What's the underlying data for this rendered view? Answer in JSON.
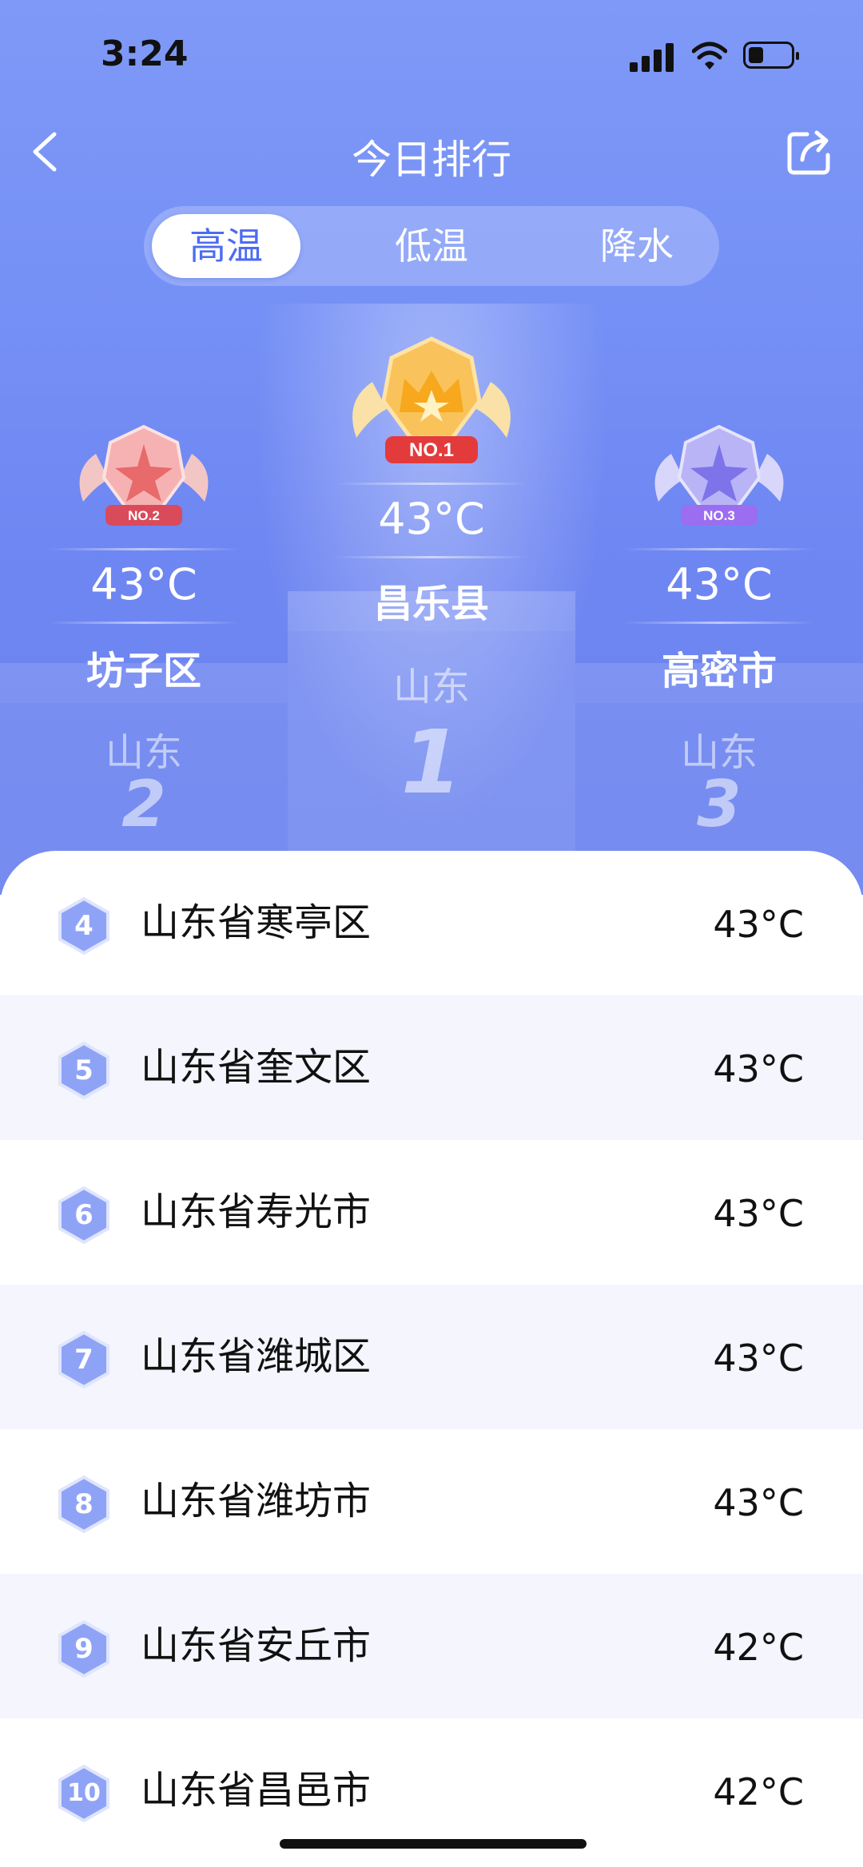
{
  "status_bar": {
    "time": "3:24"
  },
  "header": {
    "title": "今日排行"
  },
  "tabs": [
    {
      "label": "高温",
      "active": true
    },
    {
      "label": "低温",
      "active": false
    },
    {
      "label": "降水",
      "active": false
    }
  ],
  "podium": {
    "first": {
      "badge": "NO.1",
      "temp": "43°C",
      "name": "昌乐县",
      "province": "山东",
      "rank": "1"
    },
    "second": {
      "badge": "NO.2",
      "temp": "43°C",
      "name": "坊子区",
      "province": "山东",
      "rank": "2"
    },
    "third": {
      "badge": "NO.3",
      "temp": "43°C",
      "name": "高密市",
      "province": "山东",
      "rank": "3"
    }
  },
  "ranking": [
    {
      "rank": "4",
      "place": "山东省寒亭区",
      "temp": "43°C"
    },
    {
      "rank": "5",
      "place": "山东省奎文区",
      "temp": "43°C"
    },
    {
      "rank": "6",
      "place": "山东省寿光市",
      "temp": "43°C"
    },
    {
      "rank": "7",
      "place": "山东省潍城区",
      "temp": "43°C"
    },
    {
      "rank": "8",
      "place": "山东省潍坊市",
      "temp": "43°C"
    },
    {
      "rank": "9",
      "place": "山东省安丘市",
      "temp": "42°C"
    },
    {
      "rank": "10",
      "place": "山东省昌邑市",
      "temp": "42°C"
    }
  ],
  "colors": {
    "accent": "#4c6cf0",
    "hero": "#7590f6",
    "gold": "#f7b52c",
    "silver_red": "#e86a6a",
    "purple": "#8b7cf0"
  }
}
